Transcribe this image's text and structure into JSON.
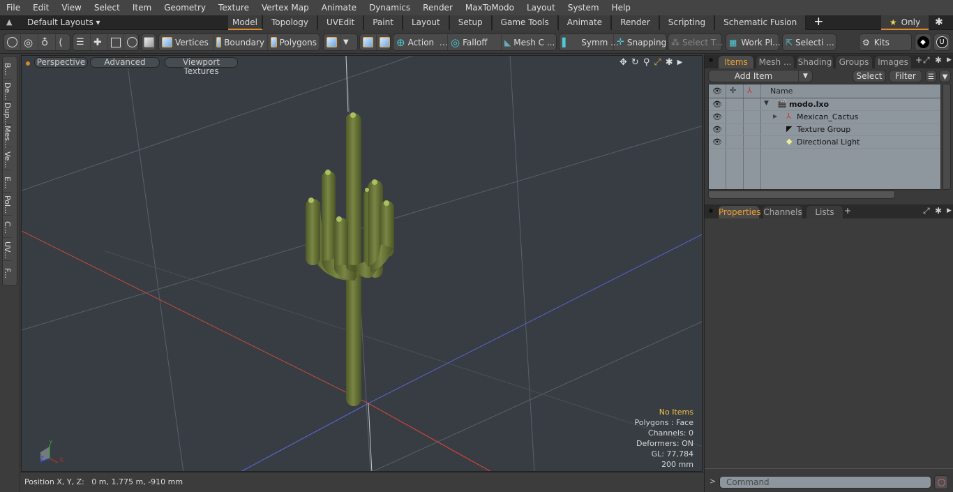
{
  "menu": [
    "File",
    "Edit",
    "View",
    "Select",
    "Item",
    "Geometry",
    "Texture",
    "Vertex Map",
    "Animate",
    "Dynamics",
    "Render",
    "MaxToModo",
    "Layout",
    "System",
    "Help"
  ],
  "layout_bar": {
    "layout_selector": "Default Layouts",
    "tabs": [
      "Model",
      "Topology",
      "UVEdit",
      "Paint",
      "Layout",
      "Setup",
      "Game Tools",
      "Animate",
      "Render",
      "Scripting",
      "Schematic Fusion"
    ],
    "active_tab": "Model",
    "add_tab": "+",
    "only_label": "Only"
  },
  "toolbar": {
    "vertices": "Vertices",
    "boundary": "Boundary",
    "polygons": "Polygons",
    "action": "Action",
    "falloff": "Falloff",
    "mesh_c": "Mesh C ...",
    "symm": "Symm ...",
    "snapping": "Snapping",
    "select_t": "Select T...",
    "work_pl": "Work Pl...",
    "selecti": "Selecti ...",
    "kits": "Kits"
  },
  "left_tabs": [
    "B...",
    "De...",
    "Dup...",
    "Mes...",
    "Ve...",
    "E...",
    "Pol...",
    "C...",
    "UV...",
    "F..."
  ],
  "viewport": {
    "perspective": "Perspective",
    "advanced": "Advanced",
    "textures": "Viewport Textures",
    "info": {
      "status": "No Items",
      "polygons": "Polygons : Face",
      "channels": "Channels: 0",
      "deformers": "Deformers: ON",
      "gl": "GL: 77,784",
      "scale": "200 mm"
    },
    "axis_labels": {
      "x": "X",
      "y": "Y",
      "z": "Z"
    },
    "colors": {
      "x_axis": "#d0453a",
      "z_axis": "#5a63d0",
      "y_axis": "#c8c8c8",
      "cactus": "#6e7a3a"
    }
  },
  "statusbar": {
    "position": "Position X, Y, Z:   0 m, 1.775 m, -910 mm"
  },
  "items_panel": {
    "tabs": [
      "Items",
      "Mesh ...",
      "Shading",
      "Groups",
      "Images"
    ],
    "active_tab": "Items",
    "add_item": "Add Item",
    "select": "Select",
    "filter": "Filter",
    "column_name": "Name",
    "items": [
      {
        "name": "modo.lxo",
        "level": 0,
        "expander": "▼",
        "icon": "scene-icon"
      },
      {
        "name": "Mexican_Cactus",
        "level": 1,
        "expander": "▶",
        "icon": "locator-icon"
      },
      {
        "name": "Texture Group",
        "level": 1,
        "expander": "",
        "icon": "texture-group-icon"
      },
      {
        "name": "Directional Light",
        "level": 1,
        "expander": "",
        "icon": "light-icon"
      }
    ]
  },
  "properties_panel": {
    "tabs": [
      "Properties",
      "Channels",
      "Lists"
    ],
    "active_tab": "Properties",
    "add_tab": "+"
  },
  "command": {
    "prompt": ">",
    "placeholder": "Command"
  }
}
